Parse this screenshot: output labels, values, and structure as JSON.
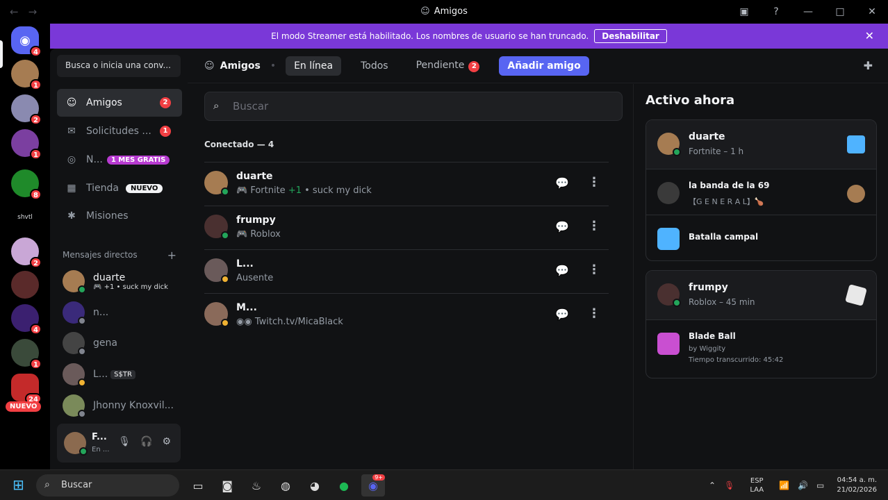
{
  "window": {
    "title": "Amigos",
    "nav_glyphs": "←→",
    "controls": [
      "▣",
      "?",
      "—",
      "□",
      "✕"
    ]
  },
  "banner": {
    "text": "El modo Streamer está habilitado. Los nombres de usuario se han truncado.",
    "button": "Deshabilitar"
  },
  "servers": {
    "badges": [
      "4",
      "1",
      "2",
      "1",
      "8",
      "2",
      "4",
      "1",
      "24"
    ],
    "label_text": "shvtl",
    "new_tag": "NUEVO"
  },
  "sidebar": {
    "search_placeholder": "Busca o inicia una conv...",
    "nav": [
      {
        "label": "Amigos",
        "count": "2"
      },
      {
        "label": "Solicitudes ...",
        "count": "1"
      },
      {
        "label": "N...",
        "promo": "1 MES GRATIS"
      },
      {
        "label": "Tienda",
        "tag": "NUEVO"
      },
      {
        "label": "Misiones"
      }
    ],
    "dm_header": "Mensajes directos",
    "dms": [
      {
        "name": "duarte",
        "sub": "🎮 +1 • suck my dick"
      },
      {
        "name": "n..."
      },
      {
        "name": "gena"
      },
      {
        "name": "L...",
        "tag": "S$TR"
      },
      {
        "name": "Jhonny Knoxvil..."
      }
    ],
    "user": {
      "name": "F...",
      "status": "En ..."
    }
  },
  "topbar": {
    "title": "Amigos",
    "tabs": [
      "En línea",
      "Todos",
      "Pendiente"
    ],
    "pending_count": "2",
    "add_button": "Añadir amigo"
  },
  "friends": {
    "search_placeholder": "Buscar",
    "section": "Conectado — 4",
    "rows": [
      {
        "name": "duarte",
        "sub": "🎮 Fortnite",
        "sub_extra": "+1",
        "sub_tail": " • suck my dick",
        "status": "online"
      },
      {
        "name": "frumpy",
        "sub": "🎮 Roblox",
        "status": "online"
      },
      {
        "name": "L...",
        "sub": "Ausente",
        "status": "idle"
      },
      {
        "name": "M...",
        "sub": "◉◉ Twitch.tv/MicaBlack",
        "status": "idle"
      }
    ]
  },
  "active_now": {
    "title": "Activo ahora",
    "cards": [
      {
        "name": "duarte",
        "sub": "Fortnite – 1 h",
        "rows": [
          {
            "name": "la banda de la 69",
            "sub": "【G E N E R A L】🍗"
          },
          {
            "name": "Batalla campal"
          }
        ]
      },
      {
        "name": "frumpy",
        "sub": "Roblox – 45 min",
        "rows": [
          {
            "name": "Blade Ball",
            "by": "by Wiggity",
            "time": "Tiempo transcurrido: 45:42"
          }
        ]
      }
    ]
  },
  "taskbar": {
    "search": "Buscar",
    "discord_badge": "9+",
    "lang": [
      "ESP",
      "LAA"
    ],
    "time": "04:54 a. m.",
    "date": "21/02/2026"
  },
  "colors": {
    "banner": "#7a38d8",
    "accent": "#5865f2",
    "danger": "#f23f43",
    "online": "#23a55a",
    "idle": "#f0b232"
  }
}
